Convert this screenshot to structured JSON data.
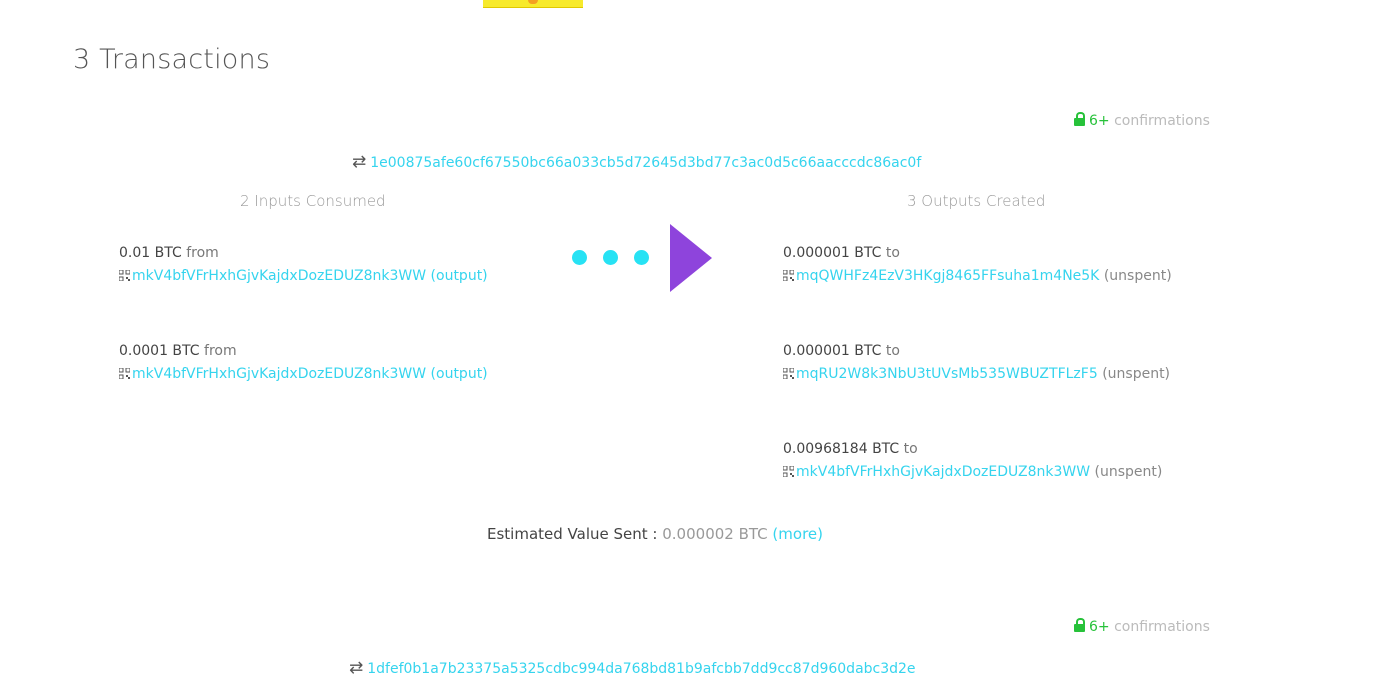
{
  "page_title": "3 Transactions",
  "transactions": [
    {
      "confirmations": {
        "count": "6+",
        "label": "confirmations"
      },
      "hash": "1e00875afe60cf67550bc66a033cb5d72645d3bd77c3ac0d5c66aacccdc86ac0f",
      "inputs_heading": "2 Inputs Consumed",
      "outputs_heading": "3 Outputs Created",
      "inputs": [
        {
          "amount": "0.01 BTC",
          "label": "from",
          "address": "mkV4bfVFrHxhGjvKajdxDozEDUZ8nk3WW",
          "tag": "(output)"
        },
        {
          "amount": "0.0001 BTC",
          "label": "from",
          "address": "mkV4bfVFrHxhGjvKajdxDozEDUZ8nk3WW",
          "tag": "(output)"
        }
      ],
      "outputs": [
        {
          "amount": "0.000001 BTC",
          "label": "to",
          "address": "mqQWHFz4EzV3HKgj8465FFsuha1m4Ne5K",
          "tag": "(unspent)"
        },
        {
          "amount": "0.000001 BTC",
          "label": "to",
          "address": "mqRU2W8k3NbU3tUVsMb535WBUZTFLzF5",
          "tag": "(unspent)"
        },
        {
          "amount": "0.00968184 BTC",
          "label": "to",
          "address": "mkV4bfVFrHxhGjvKajdxDozEDUZ8nk3WW",
          "tag": "(unspent)"
        }
      ],
      "estimated": {
        "label": "Estimated Value Sent :",
        "value": "0.000002 BTC",
        "more": "(more)"
      }
    },
    {
      "confirmations": {
        "count": "6+",
        "label": "confirmations"
      },
      "hash": "1dfef0b1a7b23375a5325cdbc994da768bd81b9afcbb7dd9cc87d960dabc3d2e"
    }
  ],
  "icons": {
    "lock": "lock-icon",
    "swap": "swap-arrows-icon",
    "qr": "qr-code-icon",
    "flow": "flow-arrow-icon"
  },
  "colors": {
    "link": "#35d4ee",
    "confirm": "#27c23a",
    "arrow": "#8e44dc",
    "dots": "#27e2f4"
  }
}
